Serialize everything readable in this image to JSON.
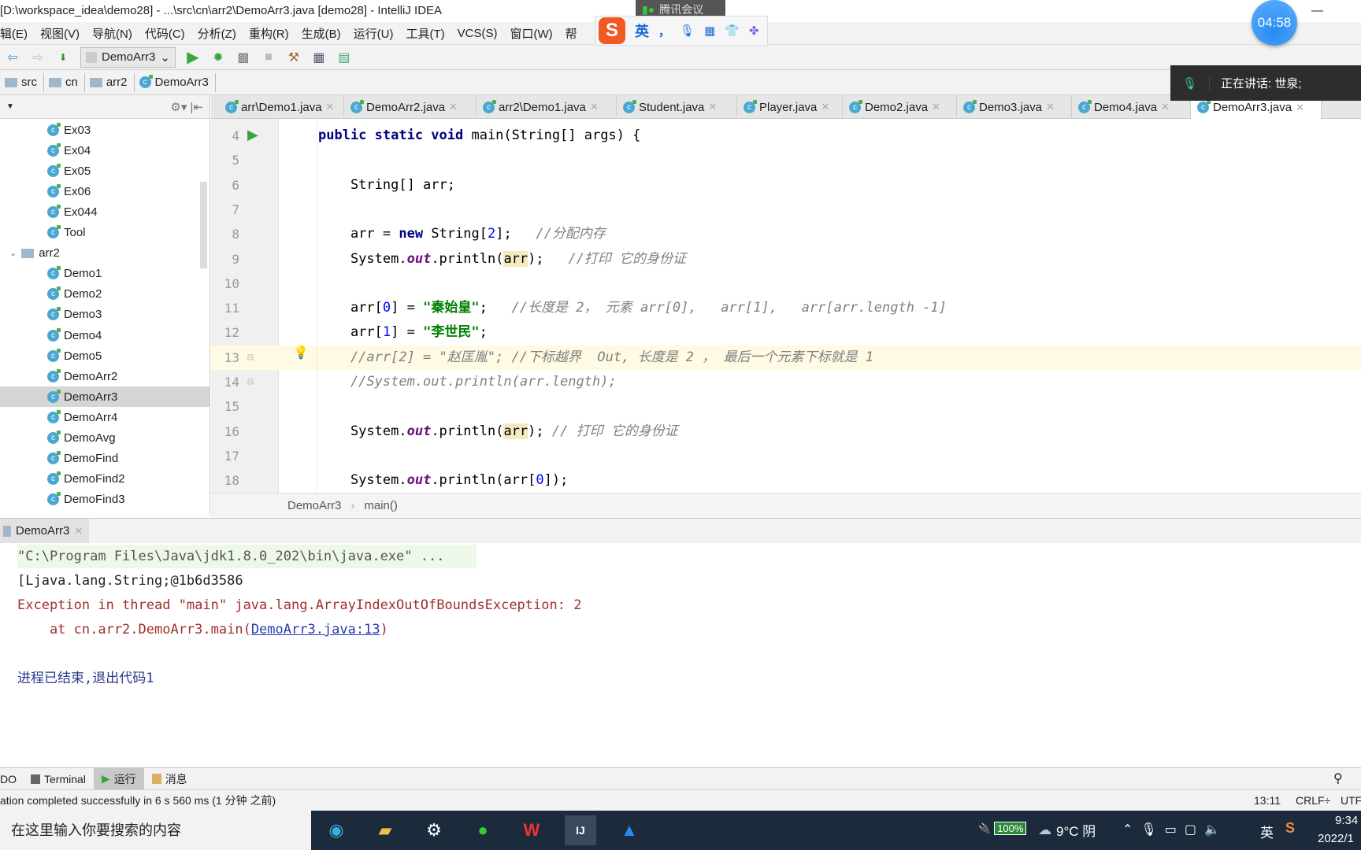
{
  "window": {
    "title": "[D:\\workspace_idea\\demo28] - ...\\src\\cn\\arr2\\DemoArr3.java [demo28] - IntelliJ IDEA",
    "minimize": "—"
  },
  "menu": [
    "辑(E)",
    "视图(V)",
    "导航(N)",
    "代码(C)",
    "分析(Z)",
    "重构(R)",
    "生成(B)",
    "运行(U)",
    "工具(T)",
    "VCS(S)",
    "窗口(W)",
    "帮"
  ],
  "toolbar": {
    "run_config": "DemoArr3"
  },
  "breadcrumb": [
    "src",
    "cn",
    "arr2",
    "DemoArr3"
  ],
  "project_tree": [
    {
      "label": "Ex03",
      "type": "class"
    },
    {
      "label": "Ex04",
      "type": "class"
    },
    {
      "label": "Ex05",
      "type": "class"
    },
    {
      "label": "Ex06",
      "type": "class"
    },
    {
      "label": "Ex044",
      "type": "class"
    },
    {
      "label": "Tool",
      "type": "class"
    },
    {
      "label": "arr2",
      "type": "folder"
    },
    {
      "label": "Demo1",
      "type": "class"
    },
    {
      "label": "Demo2",
      "type": "class"
    },
    {
      "label": "Demo3",
      "type": "class"
    },
    {
      "label": "Demo4",
      "type": "class"
    },
    {
      "label": "Demo5",
      "type": "class"
    },
    {
      "label": "DemoArr2",
      "type": "class"
    },
    {
      "label": "DemoArr3",
      "type": "class",
      "selected": true
    },
    {
      "label": "DemoArr4",
      "type": "class"
    },
    {
      "label": "DemoAvg",
      "type": "class"
    },
    {
      "label": "DemoFind",
      "type": "class"
    },
    {
      "label": "DemoFind2",
      "type": "class"
    },
    {
      "label": "DemoFind3",
      "type": "class"
    }
  ],
  "tabs": [
    {
      "label": "arr\\Demo1.java"
    },
    {
      "label": "DemoArr2.java"
    },
    {
      "label": "arr2\\Demo1.java"
    },
    {
      "label": "Student.java"
    },
    {
      "label": "Player.java"
    },
    {
      "label": "Demo2.java"
    },
    {
      "label": "Demo3.java"
    },
    {
      "label": "Demo4.java"
    },
    {
      "label": "DemoArr3.java",
      "active": true
    }
  ],
  "code": [
    {
      "n": "4",
      "indent": "",
      "tokens": [
        [
          "kw",
          "public static void "
        ],
        [
          "",
          "main(String[] args) {"
        ]
      ]
    },
    {
      "n": "5",
      "tokens": []
    },
    {
      "n": "6",
      "tokens": [
        [
          "",
          "    String[] arr;"
        ]
      ]
    },
    {
      "n": "7",
      "tokens": []
    },
    {
      "n": "8",
      "tokens": [
        [
          "",
          "    arr = "
        ],
        [
          "kw",
          "new "
        ],
        [
          "",
          "String["
        ],
        [
          "num",
          "2"
        ],
        [
          "",
          "];   "
        ],
        [
          "cmt",
          "//分配内存"
        ]
      ]
    },
    {
      "n": "9",
      "tokens": [
        [
          "",
          "    System."
        ],
        [
          "out",
          "out"
        ],
        [
          "",
          ".println("
        ],
        [
          "hl",
          "arr"
        ],
        [
          "",
          ");   "
        ],
        [
          "cmt",
          "//打印 它的身份证"
        ]
      ]
    },
    {
      "n": "10",
      "tokens": []
    },
    {
      "n": "11",
      "tokens": [
        [
          "",
          "    arr["
        ],
        [
          "num",
          "0"
        ],
        [
          "",
          "] = "
        ],
        [
          "str",
          "\"秦始皇\""
        ],
        [
          "",
          ";   "
        ],
        [
          "cmt",
          "//长度是 2， 元素 arr[0],   arr[1],   arr[arr.length -1]"
        ]
      ]
    },
    {
      "n": "12",
      "tokens": [
        [
          "",
          "    arr["
        ],
        [
          "num",
          "1"
        ],
        [
          "",
          "] = "
        ],
        [
          "str",
          "\"李世民\""
        ],
        [
          "",
          ";"
        ]
      ]
    },
    {
      "n": "13",
      "current": true,
      "tokens": [
        [
          "cmt",
          "    //arr[2] = \"赵匡胤\"; //下标越界  Out, 长度是 2 ， 最后一个元素下标就是 1"
        ]
      ]
    },
    {
      "n": "14",
      "tokens": [
        [
          "cmt",
          "    //System.out.println(arr.length);"
        ]
      ]
    },
    {
      "n": "15",
      "tokens": []
    },
    {
      "n": "16",
      "tokens": [
        [
          "",
          "    System."
        ],
        [
          "out",
          "out"
        ],
        [
          "",
          ".println("
        ],
        [
          "hl",
          "arr"
        ],
        [
          "",
          "); "
        ],
        [
          "cmt",
          "// 打印 它的身份证"
        ]
      ]
    },
    {
      "n": "17",
      "tokens": []
    },
    {
      "n": "18",
      "tokens": [
        [
          "",
          "    System."
        ],
        [
          "out",
          "out"
        ],
        [
          "",
          ".println(arr["
        ],
        [
          "num",
          "0"
        ],
        [
          "",
          "]);"
        ]
      ]
    }
  ],
  "editor_breadcrumb": [
    "DemoArr3",
    "main()"
  ],
  "run": {
    "tab": "DemoArr3",
    "lines": [
      {
        "text": "\"C:\\Program Files\\Java\\jdk1.8.0_202\\bin\\java.exe\" ...",
        "color": "#555555"
      },
      {
        "text": "[Ljava.lang.String;@1b6d3586",
        "color": "#222222"
      },
      {
        "text": "Exception in thread \"main\" java.lang.ArrayIndexOutOfBoundsException: 2",
        "color": "#a0302a"
      },
      {
        "text": "    at cn.arr2.DemoArr3.main(",
        "color": "#a0302a",
        "link": "DemoArr3.java:13",
        "after": ")"
      },
      {
        "text": "",
        "color": "#222"
      },
      {
        "text": "进程已结束,退出代码1",
        "color": "#2a3a8a"
      }
    ]
  },
  "tool_windows": [
    "DO",
    "Terminal",
    "运行",
    "消息"
  ],
  "status": {
    "message": "ation completed successfully in 6 s 560 ms (1 分钟 之前)",
    "position": "13:11",
    "line_sep": "CRLF÷",
    "encoding": "UTF"
  },
  "overlays": {
    "meeting_badge": "腾讯会议",
    "timer": "04:58",
    "speaking": "正在讲话: 世泉;",
    "ime": [
      "英",
      "，"
    ]
  },
  "taskbar": {
    "search_placeholder": "在这里输入你要搜索的内容",
    "battery": "100%",
    "weather": "9°C 阴",
    "ime": "英",
    "time": "9:34",
    "date": "2022/1"
  },
  "colors": {
    "accent": "#4aa8d0",
    "run_green": "#3aa63a",
    "current_line": "#fffae3"
  }
}
